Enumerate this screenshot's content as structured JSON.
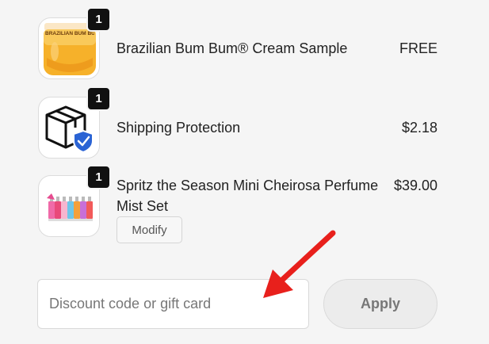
{
  "items": [
    {
      "quantity": "1",
      "name": "Brazilian Bum Bum® Cream Sample",
      "price": "FREE",
      "thumb_label": "BRAZILIAN BUM BUM CREAM",
      "thumb_icon": "cream-jar-image"
    },
    {
      "quantity": "1",
      "name": "Shipping Protection",
      "price": "$2.18",
      "thumb_icon": "package-shield-icon"
    },
    {
      "quantity": "1",
      "name": "Spritz the Season Mini Cheirosa Perfume Mist Set",
      "price": "$39.00",
      "modify_label": "Modify",
      "thumb_icon": "perfume-set-image"
    }
  ],
  "discount": {
    "placeholder": "Discount code or gift card",
    "value": ""
  },
  "apply_label": "Apply",
  "colors": {
    "background": "#f5f5f5",
    "badge": "#111111",
    "annotation_arrow": "#e8201c",
    "jar": "#f6b12a"
  }
}
